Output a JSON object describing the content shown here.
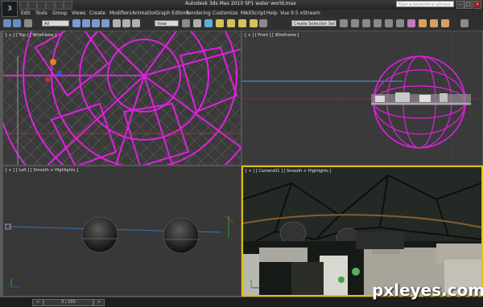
{
  "window": {
    "title": "Autodesk 3ds Max 2010 SP1     water world.max",
    "logo_text": "3"
  },
  "search": {
    "placeholder": "Type a keyword or phrase"
  },
  "menu": {
    "items": [
      "Edit",
      "Tools",
      "Group",
      "Views",
      "Create",
      "Modifiers",
      "Animation",
      "Graph Editors",
      "Rendering",
      "Customize",
      "MAXScript",
      "Help",
      "Vue 9.5 xStream"
    ]
  },
  "toolbar": {
    "filter_value": "All",
    "refcoord_value": "View",
    "selection_set_placeholder": "Create Selection Set"
  },
  "viewports": {
    "top_label": "[ + ] [ Top ] [ Wireframe ]",
    "front_label": "[ + ] [ Front ] [ Wireframe ]",
    "left_label": "[ + ] [ Left ] [ Smooth + Highlights ]",
    "camera_label": "[ + ] [ Camera01 ] [ Smooth + Highlights ]"
  },
  "timeline": {
    "frame_text": "0 / 100"
  },
  "watermark": {
    "text": "pxleyes.com"
  },
  "colors": {
    "wire_magenta": "#e020e0",
    "selection_yellow": "#e0c200",
    "grid_dark": "#3a3a3a"
  }
}
